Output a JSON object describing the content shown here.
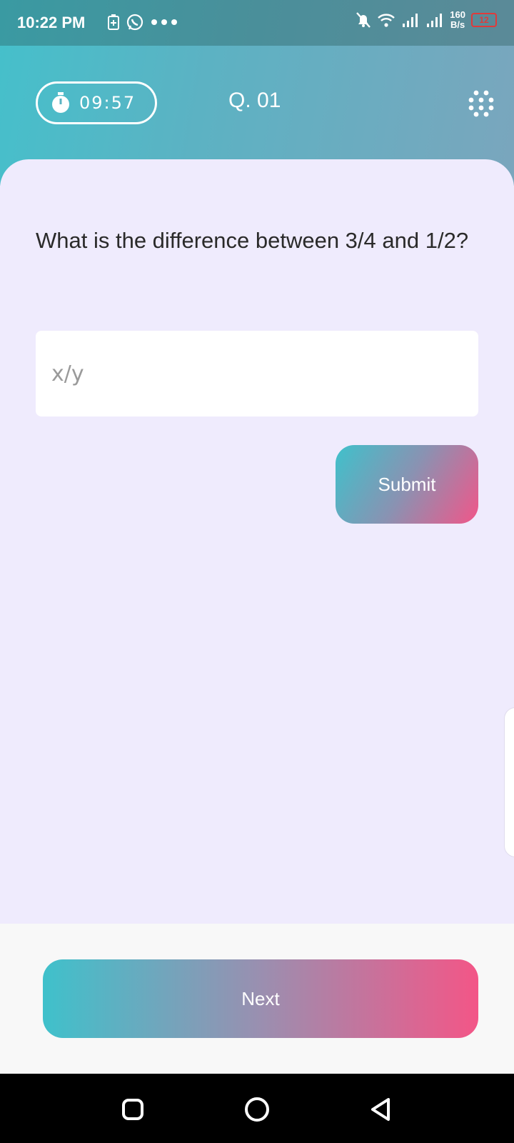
{
  "status_bar": {
    "time": "10:22 PM",
    "net_speed_value": "160",
    "net_speed_unit": "B/s",
    "battery": "12",
    "icons": [
      "battery-saver-icon",
      "whatsapp-icon",
      "more-dots-icon",
      "mute-icon",
      "wifi-icon",
      "signal-icon",
      "signal-icon"
    ]
  },
  "header": {
    "timer": "09:57",
    "question_number": "Q. 01",
    "grid_icon": "grid-dots-icon"
  },
  "question": {
    "text": "What is the difference between 3/4 and 1/2?",
    "answer_placeholder": "x/y",
    "submit_label": "Submit"
  },
  "footer": {
    "next_label": "Next"
  },
  "nav": {
    "icons": [
      "recents-icon",
      "home-icon",
      "back-icon"
    ]
  },
  "colors": {
    "accent_teal": "#45c0cb",
    "accent_pink": "#f35687",
    "card_background": "#efebfd"
  }
}
